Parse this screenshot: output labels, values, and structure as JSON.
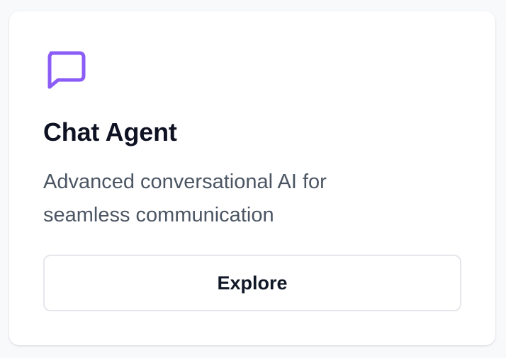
{
  "card": {
    "icon": "message-square-icon",
    "accent_color": "#8b5cf6",
    "title": "Chat Agent",
    "description": "Advanced conversational AI for seamless communication",
    "button_label": "Explore"
  }
}
